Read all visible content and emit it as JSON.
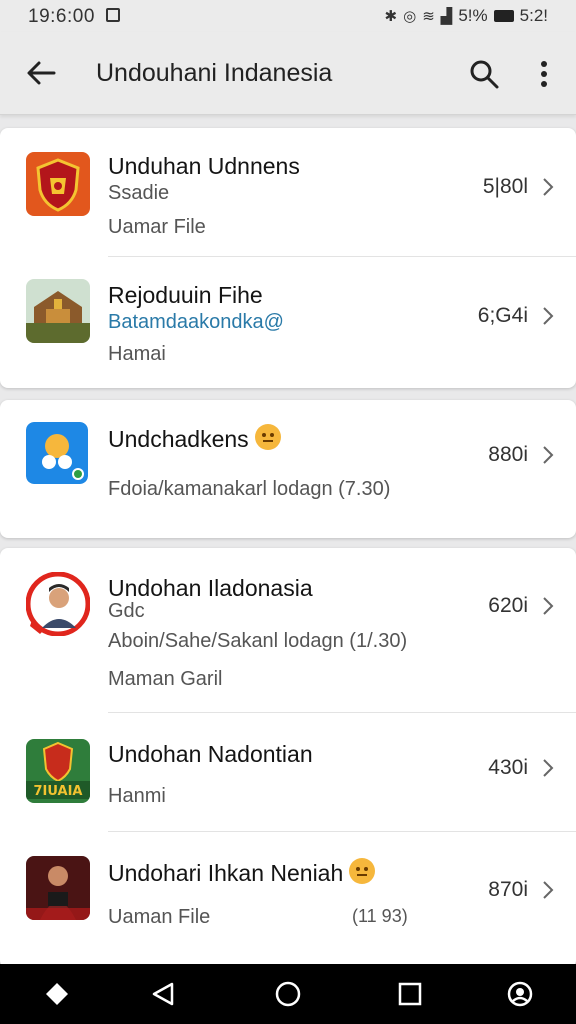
{
  "status_bar": {
    "time": "19:6:00",
    "right_text": "5!% ",
    "right_time": "5:2!",
    "icons": [
      "notification-icon",
      "alarm-icon",
      "data-icon",
      "wifi-icon",
      "signal-icon",
      "battery-icon"
    ]
  },
  "app_bar": {
    "title": "Undouhani Indanesia",
    "icons": [
      "back-arrow-icon",
      "search-icon",
      "more-vert-icon"
    ]
  },
  "groups": [
    {
      "items": [
        {
          "title": "Unduhan Udnnens",
          "line2": "Ssadie",
          "line3": "Uamar File",
          "size": "5|80l",
          "icon": "shield-crest-icon",
          "line2_style": "normal"
        },
        {
          "title": "Rejoduuin Fihe",
          "line2": "Batamdaakondka@",
          "line3": "Hamai",
          "size": "6;G4i",
          "icon": "temple-photo-icon",
          "line2_style": "link"
        }
      ]
    },
    {
      "items": [
        {
          "title": "Undchadkens",
          "line2": "Fdoia/kamanakarl lodagn (7.30)",
          "line3": "",
          "size": "880i",
          "icon": "people-app-icon",
          "emoji": "grimace-emoji-icon"
        }
      ]
    },
    {
      "items": [
        {
          "title": "Undohan Iladonasia",
          "line2": "Gdc",
          "line3": "Aboin/Sahe/Sakanl lodagn (1/.30)",
          "line4": "Maman Garil",
          "size": "620i",
          "icon": "man-portrait-icon"
        },
        {
          "title": "Undohan Nadontian",
          "line2": "Hanmi",
          "line3": "",
          "size": "430i",
          "icon": "team-logo-icon"
        },
        {
          "title": "Undohari Ihkan Neniah",
          "line2": "Uaman File",
          "line3": "(11 93)",
          "size": "870i",
          "icon": "video-thumbnail-icon",
          "emoji": "grimace-emoji-icon"
        }
      ]
    }
  ],
  "nav_bar": {
    "buttons": [
      "diamond-icon",
      "back-triangle-icon",
      "home-circle-icon",
      "recents-square-icon",
      "assistant-icon"
    ]
  },
  "colors": {
    "background": "#e9e9ea",
    "card": "#ffffff",
    "link_text": "#2a7aa8",
    "nav_bar": "#000000"
  }
}
